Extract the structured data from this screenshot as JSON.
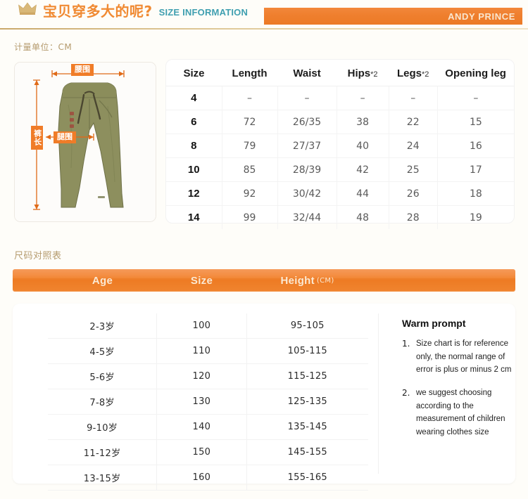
{
  "header": {
    "crown_icon": "crown-icon",
    "title_cn": "宝贝穿多大的呢?",
    "title_en": "SIZE INFORMATION",
    "brand": "ANDY PRINCE",
    "accent_orange": "#f07c28",
    "accent_teal": "#3f9fb0",
    "accent_gold": "#b59b6e"
  },
  "unit_label": "计量单位：CM",
  "photo": {
    "alt": "olive green kids trousers",
    "labels": {
      "waist": "腰围",
      "length": "裤长",
      "thigh": "腿围"
    }
  },
  "size_table": {
    "columns": [
      "Size",
      "Length",
      "Waist",
      "Hips",
      "Legs",
      "Opening leg"
    ],
    "column_multipliers": {
      "Hips": "*2",
      "Legs": "*2"
    },
    "rows": [
      {
        "size": "4",
        "length": "–",
        "waist": "–",
        "hips": "–",
        "legs": "–",
        "opening": "–"
      },
      {
        "size": "6",
        "length": "72",
        "waist": "26/35",
        "hips": "38",
        "legs": "22",
        "opening": "15"
      },
      {
        "size": "8",
        "length": "79",
        "waist": "27/37",
        "hips": "40",
        "legs": "24",
        "opening": "16"
      },
      {
        "size": "10",
        "length": "85",
        "waist": "28/39",
        "hips": "42",
        "legs": "25",
        "opening": "17"
      },
      {
        "size": "12",
        "length": "92",
        "waist": "30/42",
        "hips": "44",
        "legs": "26",
        "opening": "18"
      },
      {
        "size": "14",
        "length": "99",
        "waist": "32/44",
        "hips": "48",
        "legs": "28",
        "opening": "19"
      }
    ]
  },
  "section2": {
    "title": "尺码对照表",
    "bar": {
      "age": "Age",
      "size": "Size",
      "height": "Height",
      "height_unit": "(CM)"
    },
    "rows": [
      {
        "age": "2-3岁",
        "size": "100",
        "height": "95-105"
      },
      {
        "age": "4-5岁",
        "size": "110",
        "height": "105-115"
      },
      {
        "age": "5-6岁",
        "size": "120",
        "height": "115-125"
      },
      {
        "age": "7-8岁",
        "size": "130",
        "height": "125-135"
      },
      {
        "age": "9-10岁",
        "size": "140",
        "height": "135-145"
      },
      {
        "age": "11-12岁",
        "size": "150",
        "height": "145-155"
      },
      {
        "age": "13-15岁",
        "size": "160",
        "height": "155-165"
      }
    ]
  },
  "warm_prompt": {
    "title": "Warm prompt",
    "items": [
      {
        "num": "1.",
        "text": "Size chart is for reference only, the normal range of error is plus or minus  2 cm"
      },
      {
        "num": "2.",
        "text": "we suggest choosing according to the measurement of children wearing clothes size"
      }
    ]
  }
}
